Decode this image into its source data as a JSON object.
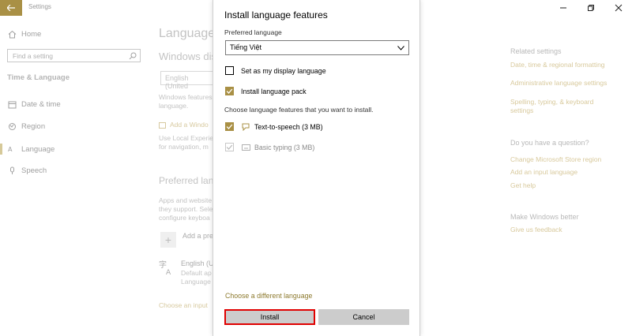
{
  "window": {
    "title": "Settings",
    "colors": {
      "accent": "#a99045",
      "highlight_border": "#e00000"
    }
  },
  "sidebar": {
    "home": "Home",
    "search_placeholder": "Find a setting",
    "section": "Time & Language",
    "items": [
      {
        "label": "Date & time",
        "icon": "clock-icon"
      },
      {
        "label": "Region",
        "icon": "globe-icon"
      },
      {
        "label": "Language",
        "icon": "language-icon"
      },
      {
        "label": "Speech",
        "icon": "microphone-icon"
      }
    ]
  },
  "main": {
    "title": "Language",
    "display_heading": "Windows disp",
    "display_select": "English (United",
    "display_desc_1": "Windows features",
    "display_desc_2": "language.",
    "add_windows": "Add a Windo",
    "local_desc_1": "Use Local Experie",
    "local_desc_2": "for navigation, m",
    "preferred_heading": "Preferred langu",
    "pref_desc_1": "Apps and website",
    "pref_desc_2": "they support. Sele",
    "pref_desc_3": "configure keyboa",
    "add_pref": "Add a pre",
    "lang_name": "English (U",
    "lang_sub_1": "Default ap",
    "lang_sub_2": "Language",
    "choose_input": "Choose an input"
  },
  "related": {
    "heading": "Related settings",
    "links": [
      "Date, time & regional formatting",
      "Administrative language settings",
      "Spelling, typing, & keyboard",
      "settings"
    ],
    "question_heading": "Do you have a question?",
    "question_links": [
      "Change Microsoft Store region",
      "Add an input language",
      "Get help"
    ],
    "better_heading": "Make Windows better",
    "feedback": "Give us feedback"
  },
  "dialog": {
    "title": "Install language features",
    "preferred_label": "Preferred language",
    "selected_language": "Tiếng Việt",
    "options": [
      {
        "label": "Set as my display language",
        "checked": false
      },
      {
        "label": "Install language pack",
        "checked": true
      }
    ],
    "features_label": "Choose language features that you want to install.",
    "features": [
      {
        "label": "Text-to-speech (3 MB)",
        "checked": true,
        "enabled": true,
        "icon": "speech-icon"
      },
      {
        "label": "Basic typing (3 MB)",
        "checked": true,
        "enabled": false,
        "icon": "keyboard-icon"
      }
    ],
    "choose_different": "Choose a different language",
    "install_label": "Install",
    "cancel_label": "Cancel"
  }
}
